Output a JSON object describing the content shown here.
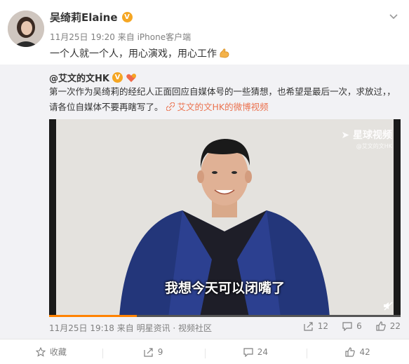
{
  "post": {
    "username": "吴绮莉Elaine",
    "verified_badge": "V",
    "timestamp": "11月25日 19:20",
    "source": "来自 iPhone客户端",
    "content": "一个人就一个人，用心演戏，用心工作",
    "emoji": "muscle-emoji"
  },
  "repost": {
    "username": "@艾文的文HK",
    "verified_badge": "V",
    "text": "第一次作为吴绮莉的经纪人正面回应自媒体号的一些猜想，也希望是最后一次，求放过，，请各位自媒体不要再瞎写了。",
    "video_link": "艾文的文HK的微博视频",
    "video": {
      "subtitle": "我想今天可以闭嘴了",
      "watermark": "星球视频",
      "watermark_sub": "@艾文的文HK",
      "progress": 0.25
    },
    "timestamp": "11月25日 19:18",
    "source": "来自 明星资讯 · 视频社区",
    "forwards": "12",
    "comments": "6",
    "likes": "22"
  },
  "footer": {
    "favorite_label": "收藏",
    "forward_count": "9",
    "comment_count": "24",
    "like_count": "42"
  },
  "colors": {
    "link": "#eb7350",
    "badge": "#f5a623",
    "repost_bg": "#f2f2f5",
    "muted": "#808080"
  }
}
